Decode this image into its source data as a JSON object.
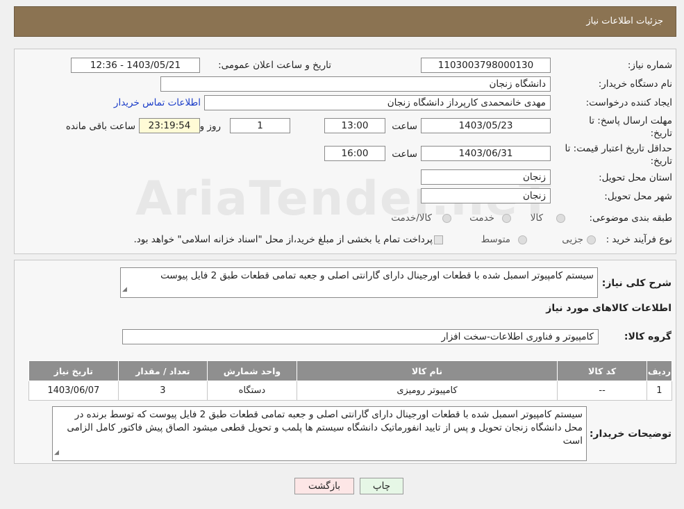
{
  "header": {
    "title": "جزئیات اطلاعات نیاز"
  },
  "form": {
    "need_number_label": "شماره نیاز:",
    "need_number": "1103003798000130",
    "announce_label": "تاریخ و ساعت اعلان عمومی:",
    "announce_value": "1403/05/21 - 12:36",
    "buyer_label": "نام دستگاه خریدار:",
    "buyer_value": "دانشگاه زنجان",
    "creator_label": "ایجاد کننده درخواست:",
    "creator_value": "مهدی خانمحمدی کارپرداز دانشگاه زنجان",
    "contact_link": "اطلاعات تماس خریدار",
    "deadline_label_1": "مهلت ارسال پاسخ: تا",
    "deadline_label_2": "تاریخ:",
    "deadline_date": "1403/05/23",
    "hour_label": "ساعت",
    "deadline_time": "13:00",
    "days_value": "1",
    "days_label": "روز و",
    "remaining_time": "23:19:54",
    "remaining_label": "ساعت باقی مانده",
    "validity_label_1": "حداقل تاریخ اعتبار قیمت: تا",
    "validity_label_2": "تاریخ:",
    "validity_date": "1403/06/31",
    "validity_hour_label": "ساعت",
    "validity_time": "16:00",
    "province_label": "استان محل تحویل:",
    "province_value": "زنجان",
    "city_label": "شهر محل تحویل:",
    "city_value": "زنجان",
    "category_label": "طبقه بندی موضوعی:",
    "category_options": [
      "کالا",
      "خدمت",
      "کالا/خدمت"
    ],
    "process_label": "نوع فرآیند خرید :",
    "process_options": [
      "جزیی",
      "متوسط"
    ],
    "process_note": "پرداخت تمام یا بخشی از مبلغ خرید،از محل \"اسناد خزانه اسلامی\" خواهد بود."
  },
  "summary": {
    "label": "شرح کلی نیاز:",
    "text": "سیستم کامپیوتر اسمبل شده با قطعات اورجینال دارای گارانتی اصلی و جعبه تمامی قطعات طبق 2 فایل پیوست",
    "items_title": "اطلاعات کالاهای مورد نیاز",
    "group_label": "گروه کالا:",
    "group_value": "کامپیوتر و فناوری اطلاعات-سخت افزار"
  },
  "table": {
    "headers": [
      "ردیف",
      "کد کالا",
      "نام کالا",
      "واحد شمارش",
      "تعداد / مقدار",
      "تاریخ نیاز"
    ],
    "rows": [
      [
        "1",
        "--",
        "کامپیوتر رومیزی",
        "دستگاه",
        "3",
        "1403/06/07"
      ]
    ]
  },
  "buyer_notes": {
    "label": "توضیحات خریدار:",
    "text": "سیستم کامپیوتر اسمبل شده با قطعات اورجینال دارای گارانتی اصلی و جعبه تمامی قطعات طبق 2 فایل پیوست که توسط برنده در محل دانشگاه زنجان تحویل و پس از تایید انفورماتیک دانشگاه سیستم ها پلمب و تحویل قطعی میشود الصاق پیش فاکتور کامل الزامی است"
  },
  "buttons": {
    "print": "چاپ",
    "back": "بازگشت"
  },
  "watermark": "AriaTender.neT",
  "colors": {
    "header_bg": "#8b7352",
    "table_header_bg": "#8f8f8f",
    "link": "#1a3cc8",
    "back_button_bg": "#fde6e6",
    "print_button_bg": "#e6f7e6"
  }
}
